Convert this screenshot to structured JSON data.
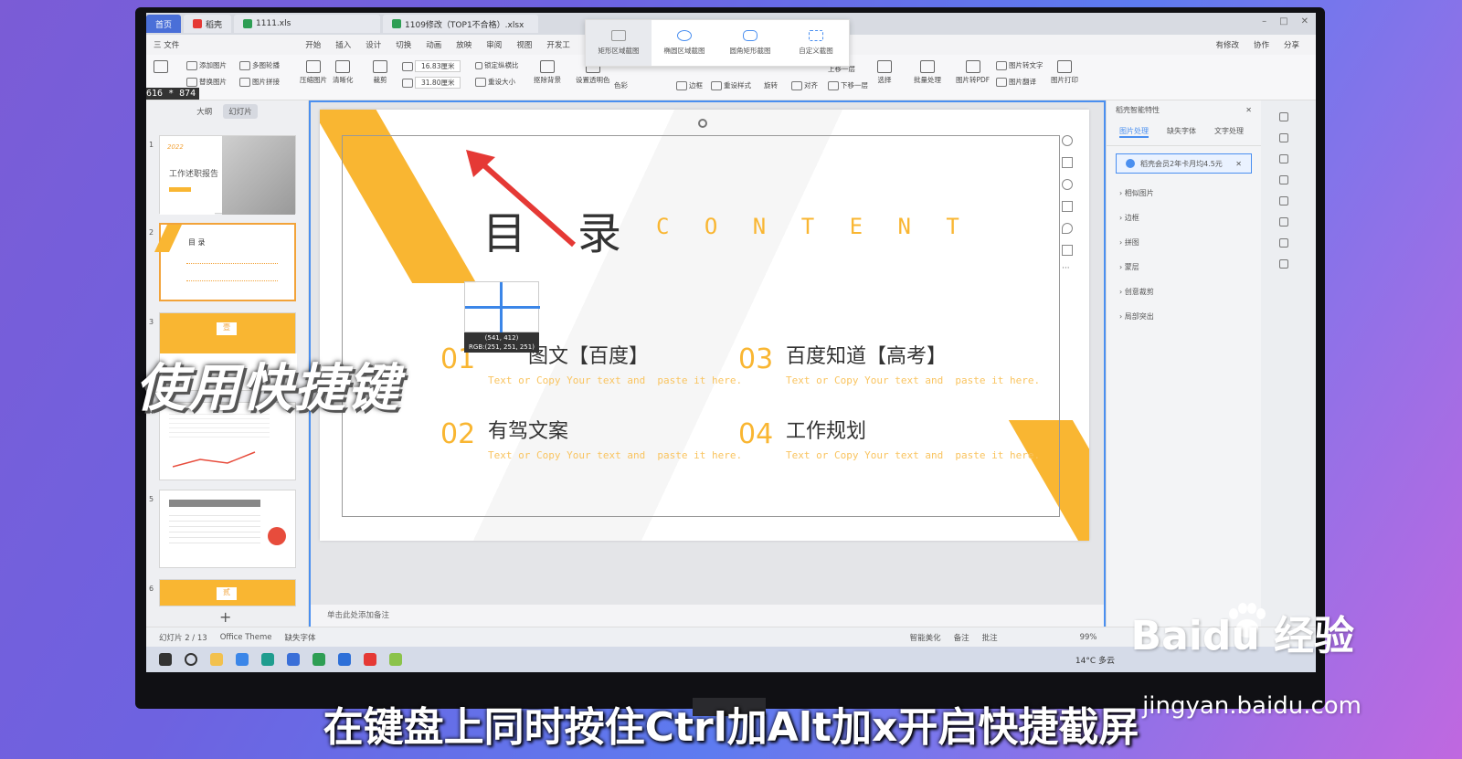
{
  "tabs": [
    {
      "label": "首页",
      "color": "#4a6fd8"
    },
    {
      "label": "稻壳",
      "color": "#e53935"
    },
    {
      "label": "1111.xls",
      "color": "#2e9e54"
    },
    {
      "label": "1109修改（TOP1不合格）.xlsx",
      "color": "#2e9e54"
    }
  ],
  "menu": {
    "file": "三 文件",
    "items": [
      "开始",
      "插入",
      "设计",
      "切换",
      "动画",
      "放映",
      "审阅",
      "视图",
      "开发工"
    ],
    "right": [
      "有修改",
      "协作",
      "分享"
    ]
  },
  "ribbon": {
    "add_image": "添加图片",
    "multi_carousel": "多图轮播",
    "replace_image": "替换图片",
    "image_collage": "图片拼接",
    "compress": "压缩图片",
    "sharpen": "清晰化",
    "crop": "裁剪",
    "width": "16.83厘米",
    "height": "31.80厘米",
    "lock_ratio": "锁定纵横比",
    "reset_size": "重设大小",
    "remove_bg": "抠除背景",
    "set_transparent": "设置透明色",
    "color": "色彩",
    "border": "边框",
    "reset_style": "重设样式",
    "rotate": "旋转",
    "align": "对齐",
    "up_layer": "上移一层",
    "down_layer": "下移一层",
    "select": "选择",
    "batch": "批量处理",
    "to_pdf": "图片转PDF",
    "to_text": "图片转文字",
    "translate": "图片翻译",
    "print": "图片打印"
  },
  "size_readout": "616 * 874",
  "screenshot_toolbar": [
    "矩形区域截图",
    "椭圆区域截图",
    "圆角矩形截图",
    "自定义截图"
  ],
  "left_panel": {
    "tabs": [
      "大纲",
      "幻灯片"
    ],
    "slides": [
      {
        "num": "1",
        "year": "2022",
        "title": "工作述职报告"
      },
      {
        "num": "2",
        "title": "目  录"
      },
      {
        "num": "3",
        "banner": "壹"
      },
      {
        "num": "4"
      },
      {
        "num": "5"
      },
      {
        "num": "6",
        "banner": "贰"
      }
    ]
  },
  "slide": {
    "title": "目",
    "title2": "录",
    "content_word": "C O N T E N T",
    "items": [
      {
        "num": "01",
        "title": "图文【百度】",
        "sub": "Text or Copy Your text and  paste it here."
      },
      {
        "num": "02",
        "title": "有驾文案",
        "sub": "Text or Copy Your text and  paste it here."
      },
      {
        "num": "03",
        "title": "百度知道【高考】",
        "sub": "Text or Copy Your text and  paste it here."
      },
      {
        "num": "04",
        "title": "工作规划",
        "sub": "Text or Copy Your text and  paste it here."
      }
    ],
    "accent": "#f9b632",
    "coord": "(541, 412)",
    "rgb": "RGB:(251, 251, 251)"
  },
  "notes_placeholder": "单击此处添加备注",
  "right_panel": {
    "header": "稻壳智能特性",
    "tabs": [
      "图片处理",
      "缺失字体",
      "文字处理"
    ],
    "promo": "稻壳会员2年卡月均4.5元",
    "items": [
      "相似图片",
      "边框",
      "拼图",
      "蒙层",
      "创意裁剪",
      "局部突出"
    ]
  },
  "status": {
    "slide_count": "幻灯片 2 / 13",
    "theme": "Office Theme",
    "missing_font": "缺失字体",
    "beautify": "智能美化",
    "notes": "备注",
    "comments": "批注",
    "zoom": "99%"
  },
  "taskbar": {
    "weather": "14°C 多云"
  },
  "overlay": {
    "side_caption": "使用快捷键",
    "caption": "在键盘上同时按住Ctrl加Alt加x开启快捷截屏",
    "brand": "Baidu 经验",
    "brand_url": "jingyan.baidu.com"
  }
}
